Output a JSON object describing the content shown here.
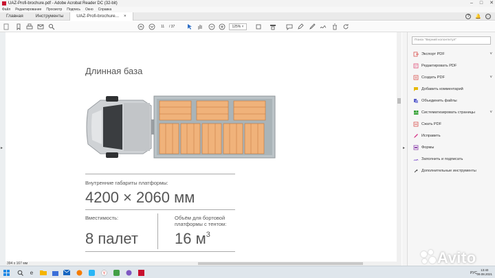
{
  "window": {
    "title": "UAZ-Profi-brochure.pdf - Adobe Acrobat Reader DC (32-bit)",
    "controls": [
      "–",
      "□",
      "✕"
    ]
  },
  "menu": [
    "Файл",
    "Редактирование",
    "Просмотр",
    "Подпись",
    "Окно",
    "Справка"
  ],
  "tabs": {
    "home": "Главная",
    "tools": "Инструменты",
    "doc": "UAZ-Profi-brochure...",
    "doc_close": "×",
    "help": "?",
    "bell": "🔔"
  },
  "toolbar": {
    "page_current": "11",
    "page_total": "/ 37",
    "zoom": "125%"
  },
  "document": {
    "heading": "Длинная база",
    "platform_label": "Внутренние габариты платформы:",
    "platform_dims": "4200 × 2060 мм",
    "capacity_label": "Вместимость:",
    "capacity_value": "8 палет",
    "volume_label": "Объём для бортовой платформы с тентом:",
    "volume_value": "16 м",
    "volume_sup": "3",
    "page_size": "394 x 167 мм"
  },
  "right_panel": {
    "search_placeholder": "Поиск \"Верний колонтитул\"",
    "items": [
      {
        "label": "Экспорт PDF",
        "color": "#d9534f",
        "chevron": "˅"
      },
      {
        "label": "Редактировать PDF",
        "color": "#e0507a",
        "chevron": ""
      },
      {
        "label": "Создать PDF",
        "color": "#d9534f",
        "chevron": "˅"
      },
      {
        "label": "Добавить комментарий",
        "color": "#e5b800",
        "chevron": ""
      },
      {
        "label": "Объединить файлы",
        "color": "#5a5fc8",
        "chevron": ""
      },
      {
        "label": "Систематизировать страницы",
        "color": "#3aa43a",
        "chevron": "˅"
      },
      {
        "label": "Сжать PDF",
        "color": "#d9534f",
        "chevron": ""
      },
      {
        "label": "Исправить",
        "color": "#d63b8a",
        "chevron": ""
      },
      {
        "label": "Формы",
        "color": "#8e44ad",
        "chevron": ""
      },
      {
        "label": "Заполнить и подписать",
        "color": "#7c4dcc",
        "chevron": ""
      },
      {
        "label": "Дополнительные инструменты",
        "color": "#444444",
        "chevron": ""
      }
    ]
  },
  "taskbar": {
    "lang": "РУС",
    "time": "13:40",
    "date": "09.08.2021"
  },
  "watermark": "Avito"
}
